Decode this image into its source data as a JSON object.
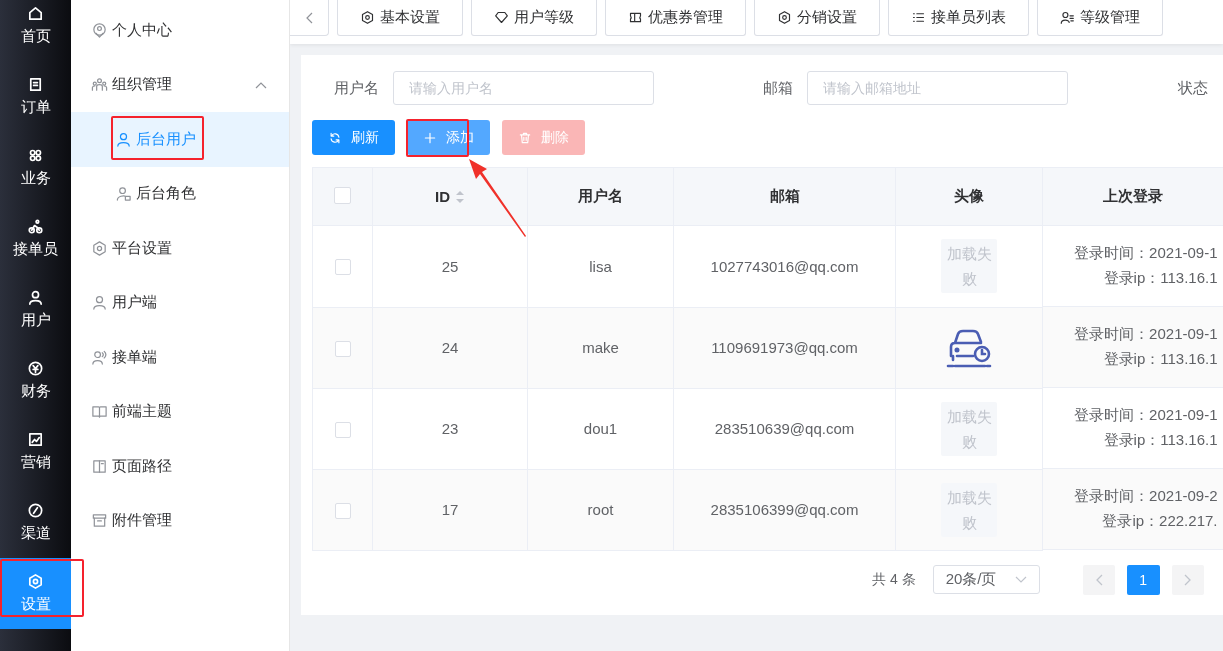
{
  "rail": {
    "items": [
      {
        "label": "首页",
        "selected": false,
        "annotated": false
      },
      {
        "label": "订单",
        "selected": false,
        "annotated": false
      },
      {
        "label": "业务",
        "selected": false,
        "annotated": false
      },
      {
        "label": "接单员",
        "selected": false,
        "annotated": false
      },
      {
        "label": "用户",
        "selected": false,
        "annotated": false
      },
      {
        "label": "财务",
        "selected": false,
        "annotated": false
      },
      {
        "label": "营销",
        "selected": false,
        "annotated": false
      },
      {
        "label": "渠道",
        "selected": false,
        "annotated": false
      },
      {
        "label": "设置",
        "selected": true,
        "annotated": true
      }
    ]
  },
  "submenu": {
    "items": [
      {
        "label": "个人中心",
        "selected": false
      },
      {
        "label": "组织管理",
        "selected": false,
        "expanded": true,
        "children": [
          {
            "label": "后台用户",
            "selected": true,
            "annotated": true
          },
          {
            "label": "后台角色",
            "selected": false,
            "annotated": false
          }
        ]
      },
      {
        "label": "平台设置",
        "selected": false
      },
      {
        "label": "用户端",
        "selected": false
      },
      {
        "label": "接单端",
        "selected": false
      },
      {
        "label": "前端主题",
        "selected": false
      },
      {
        "label": "页面路径",
        "selected": false
      },
      {
        "label": "附件管理",
        "selected": false
      }
    ]
  },
  "tabs": [
    {
      "label": "基本设置",
      "selected": false
    },
    {
      "label": "用户等级",
      "selected": false
    },
    {
      "label": "优惠券管理",
      "selected": false
    },
    {
      "label": "分销设置",
      "selected": false
    },
    {
      "label": "接单员列表",
      "selected": false
    },
    {
      "label": "等级管理",
      "selected": false
    }
  ],
  "filters": [
    {
      "label": "用户名",
      "placeholder": "请输入用户名"
    },
    {
      "label": "邮箱",
      "placeholder": "请输入邮箱地址"
    },
    {
      "label": "状态"
    }
  ],
  "buttons": [
    {
      "label": "刷新",
      "kind": "refresh",
      "disabled": false,
      "annotated": false
    },
    {
      "label": "添加",
      "kind": "add",
      "disabled": false,
      "annotated": true
    },
    {
      "label": "删除",
      "kind": "delete",
      "disabled": true,
      "annotated": false
    }
  ],
  "table": {
    "select_all_checked": false,
    "columns": [
      {
        "label": "ID",
        "sortable": true
      },
      {
        "label": "用户名",
        "sortable": false
      },
      {
        "label": "邮箱",
        "sortable": false
      },
      {
        "label": "头像",
        "sortable": false
      },
      {
        "label": "上次登录",
        "sortable": false
      }
    ],
    "rows": [
      {
        "checked": false,
        "id": "25",
        "username": "lisa",
        "email": "1027743016@qq.com",
        "avatar": {
          "kind": "failed",
          "text": "加载失败"
        },
        "login_time": "登录时间：2021-09-1",
        "login_ip": "登录ip：113.16.1"
      },
      {
        "checked": false,
        "id": "24",
        "username": "make",
        "email": "1109691973@qq.com",
        "avatar": {
          "kind": "image"
        },
        "login_time": "登录时间：2021-09-1",
        "login_ip": "登录ip：113.16.1"
      },
      {
        "checked": false,
        "id": "23",
        "username": "dou1",
        "email": "283510639@qq.com",
        "avatar": {
          "kind": "failed",
          "text": "加载失败"
        },
        "login_time": "登录时间：2021-09-1",
        "login_ip": "登录ip：113.16.1"
      },
      {
        "checked": false,
        "id": "17",
        "username": "root",
        "email": "2835106399@qq.com",
        "avatar": {
          "kind": "failed",
          "text": "加载失败"
        },
        "login_time": "登录时间：2021-09-2",
        "login_ip": "登录ip：222.217."
      }
    ]
  },
  "pagination": {
    "total": "共 4 条",
    "page_size": "20条/页",
    "pages": [
      {
        "label": "1",
        "selected": true
      }
    ]
  }
}
